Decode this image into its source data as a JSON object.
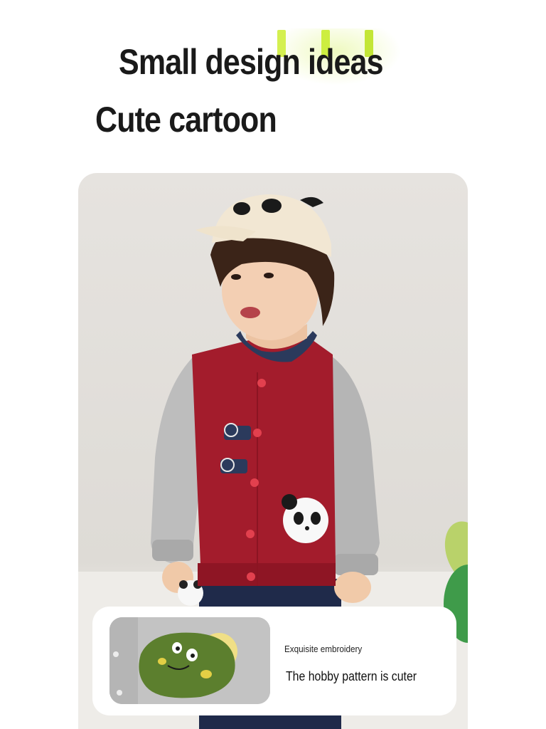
{
  "headings": {
    "line1": "Small design ideas",
    "line2": "Cute cartoon"
  },
  "feature_card": {
    "label": "Exquisite embroidery",
    "caption": "The hobby pattern is cuter"
  },
  "colors": {
    "accent_green": "#c8ea3a",
    "jacket_red": "#a31c2c",
    "sleeve_gray": "#bcbcbc",
    "collar_navy": "#2b3a5c",
    "background": "#ffffff",
    "photo_bg": "#e4e1dc"
  },
  "icons": [
    "panda-cap-icon",
    "paw-badge-icon",
    "panda-patch-icon",
    "dinosaur-embroidery-icon"
  ]
}
